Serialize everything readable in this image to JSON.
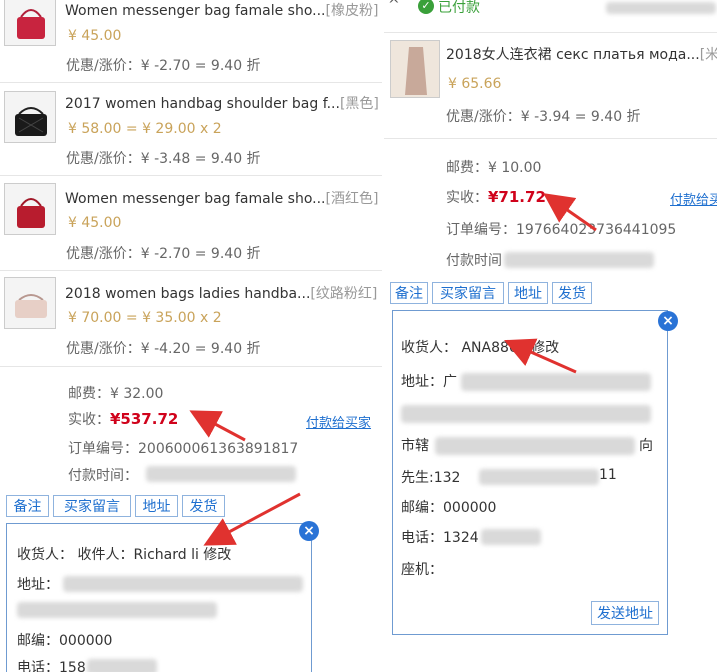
{
  "left": {
    "items": [
      {
        "title": "Women messenger bag famale sho...",
        "attr": "[橡皮粉]",
        "price": "¥ 45.00",
        "discount": "优惠/涨价：¥ -2.70 = 9.40 折",
        "thumb": "red-handbag"
      },
      {
        "title": "2017 women handbag shoulder bag f...",
        "attr": "[黑色]",
        "price": "¥ 58.00 = ¥ 29.00 x 2",
        "discount": "优惠/涨价：¥ -3.48 = 9.40 折",
        "thumb": "black-bag"
      },
      {
        "title": "Women messenger bag famale sho...",
        "attr": "[酒红色]",
        "price": "¥ 45.00",
        "discount": "优惠/涨价：¥ -2.70 = 9.40 折",
        "thumb": "red-handbag"
      },
      {
        "title": "2018 women bags ladies handba...",
        "attr": "[纹路粉红]",
        "price": "¥ 70.00 = ¥ 35.00 x 2",
        "discount": "优惠/涨价：¥ -4.20 = 9.40 折",
        "thumb": "pink-bag"
      }
    ],
    "postage": "邮费：¥ 32.00",
    "paid_label": "实收：",
    "paid_value": "¥537.72",
    "pay_link": "付款给买家",
    "order_no": "订单编号：20060006136389181​7",
    "pay_time": "付款时间：",
    "buttons": [
      "备注",
      "买家留言",
      "地址",
      "发货"
    ],
    "address": {
      "receiver": "收货人： 收件人：Richard li 修改",
      "addr": "地址：",
      "zip": "邮编：000000",
      "phone": "电话：158"
    }
  },
  "right": {
    "status_caret": "^",
    "status_label": "已付款",
    "item": {
      "title": "2018女人连衣裙 секс платья мода...",
      "attr": "[米色]",
      "price": "¥ 65.66",
      "discount": "优惠/涨价：¥ -3.94 = 9.40 折",
      "thumb": "beige-coat"
    },
    "postage": "邮费：¥ 10.00",
    "paid_label": "实收：",
    "paid_value": "¥71.72",
    "pay_link": "付款给买",
    "order_no": "订单编号：19766402373644109​5",
    "pay_time": "付款时间",
    "buttons": [
      "备注",
      "买家留言",
      "地址",
      "发货"
    ],
    "address": {
      "receiver": "收货人： ANA8866 修改",
      "addr": "地址：广",
      "extra1": "市辖",
      "extra1_tail": "向",
      "sender": "先生:132",
      "sender_tail": "11",
      "zip": "邮编：000000",
      "phone": "电话：1324",
      "landline": "座机：",
      "send_btn": "发送地址"
    }
  },
  "colors": {
    "accent": "#1e6fcf",
    "red": "#d0021b",
    "price": "#c9a35a",
    "arrow": "#e0322f"
  }
}
